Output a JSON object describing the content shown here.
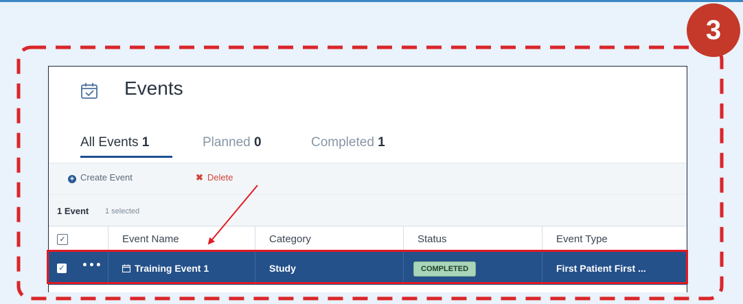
{
  "step": {
    "number": "3"
  },
  "header": {
    "title": "Events",
    "icon": "calendar-check-icon"
  },
  "tabs": [
    {
      "label": "All Events",
      "count": "1",
      "active": true
    },
    {
      "label": "Planned",
      "count": "0",
      "active": false
    },
    {
      "label": "Completed",
      "count": "1",
      "active": false
    }
  ],
  "toolbar": {
    "create_label": "Create Event",
    "create_icon": "plus-circle-icon",
    "delete_label": "Delete",
    "delete_icon": "x-icon"
  },
  "summary": {
    "count": "1 Event",
    "selected": "1 selected"
  },
  "table": {
    "columns": [
      "Event Name",
      "Category",
      "Status",
      "Event Type"
    ],
    "rows": [
      {
        "event_name": "Training Event 1",
        "category": "Study",
        "status": "COMPLETED",
        "event_type": "First Patient First ...",
        "selected": true
      }
    ]
  },
  "colors": {
    "accent": "#24518a",
    "annotation_red": "#e11b22",
    "step_badge": "#c4392a",
    "status_completed_bg": "#a9d5b8"
  }
}
